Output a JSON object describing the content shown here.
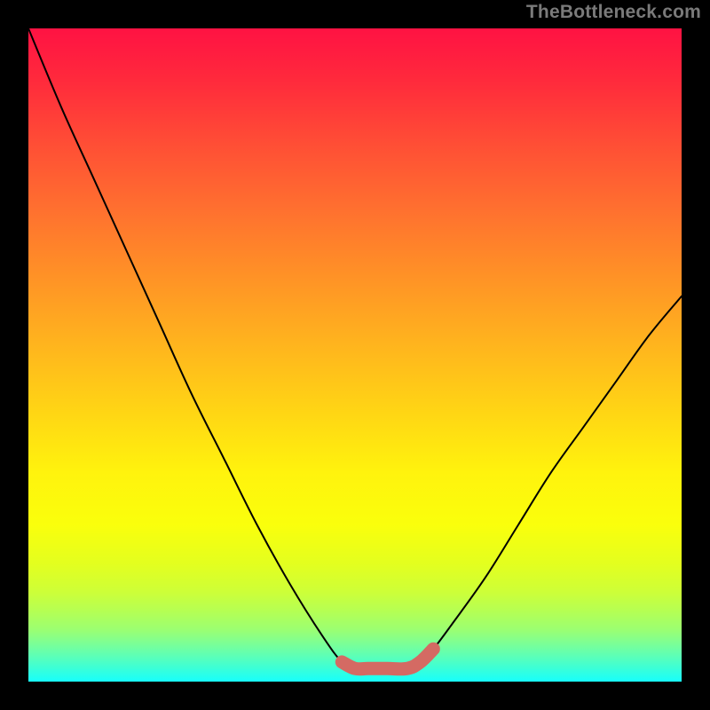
{
  "watermark": "TheBottleneck.com",
  "chart_data": {
    "type": "line",
    "title": "",
    "xlabel": "",
    "ylabel": "",
    "xlim": [
      0,
      100
    ],
    "ylim": [
      0,
      100
    ],
    "series": [
      {
        "name": "curve",
        "color": "#000000",
        "x": [
          0,
          5,
          10,
          15,
          20,
          25,
          30,
          35,
          40,
          45,
          48,
          50,
          52,
          55,
          58,
          60,
          62,
          65,
          70,
          75,
          80,
          85,
          90,
          95,
          100
        ],
        "values": [
          100,
          88,
          77,
          66,
          55,
          44,
          34,
          24,
          15,
          7,
          3,
          2,
          2,
          2,
          2,
          3,
          5,
          9,
          16,
          24,
          32,
          39,
          46,
          53,
          59
        ]
      },
      {
        "name": "plateau-marker",
        "color": "#d46a63",
        "x": [
          48,
          50,
          52,
          55,
          58,
          60,
          62
        ],
        "values": [
          3,
          2,
          2,
          2,
          2,
          3,
          5
        ]
      }
    ]
  },
  "colors": {
    "background": "#000000",
    "watermark": "#7a7a7a",
    "curve": "#000000",
    "marker": "#d46a63"
  }
}
